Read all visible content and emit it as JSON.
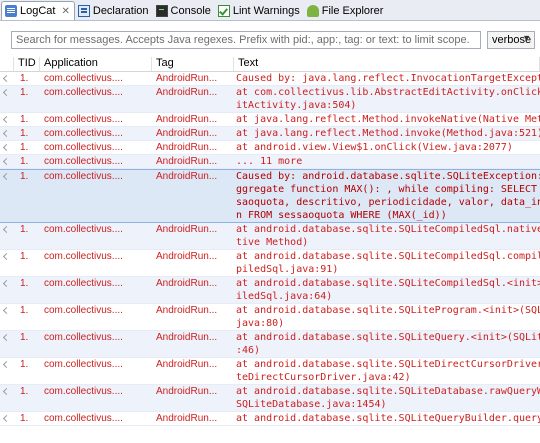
{
  "tabs": [
    {
      "label": "LogCat",
      "icon": "logcat-icon",
      "active": true
    },
    {
      "label": "Declaration",
      "icon": "declaration-icon"
    },
    {
      "label": "Console",
      "icon": "console-icon"
    },
    {
      "label": "Lint Warnings",
      "icon": "lint-warnings-icon"
    },
    {
      "label": "File Explorer",
      "icon": "file-explorer-icon"
    }
  ],
  "close_glyph": "✕",
  "search": {
    "placeholder": "Search for messages. Accepts Java regexes. Prefix with pid:, app:, tag: or text: to limit scope."
  },
  "level_select": {
    "value": "verbose"
  },
  "columns": [
    "TID",
    "Application",
    "Tag",
    "Text"
  ],
  "rows": [
    {
      "tid": "1.",
      "app": "com.collectivus....",
      "tag": "AndroidRun...",
      "text": [
        "Caused by: java.lang.reflect.InvocationTargetException"
      ]
    },
    {
      "tid": "1.",
      "app": "com.collectivus....",
      "tag": "AndroidRun...",
      "text": [
        "at com.collectivus.lib.AbstractEditActivity.onClick(Abstra",
        "itActivity.java:504)"
      ]
    },
    {
      "tid": "1.",
      "app": "com.collectivus....",
      "tag": "AndroidRun...",
      "text": [
        "at java.lang.reflect.Method.invokeNative(Native Method)"
      ]
    },
    {
      "tid": "1.",
      "app": "com.collectivus....",
      "tag": "AndroidRun...",
      "text": [
        "at java.lang.reflect.Method.invoke(Method.java:521)"
      ]
    },
    {
      "tid": "1.",
      "app": "com.collectivus....",
      "tag": "AndroidRun...",
      "text": [
        "at android.view.View$1.onClick(View.java:2077)"
      ]
    },
    {
      "tid": "1.",
      "app": "com.collectivus....",
      "tag": "AndroidRun...",
      "text": [
        "... 11 more"
      ]
    },
    {
      "tid": "1.",
      "app": "com.collectivus....",
      "tag": "AndroidRun...",
      "text": [
        "Caused by: android.database.sqlite.SQLiteException: misuse",
        "ggregate function MAX(): , while compiling: SELECT _id, nc",
        "saoquota, descritivo, periodicidade, valor, data_inici, da",
        "n FROM sessaoquota WHERE (MAX(_id))"
      ],
      "selected": true
    },
    {
      "tid": "1.",
      "app": "com.collectivus....",
      "tag": "AndroidRun...",
      "text": [
        "at android.database.sqlite.SQLiteCompiledSql.native_compil",
        "tive Method)"
      ]
    },
    {
      "tid": "1.",
      "app": "com.collectivus....",
      "tag": "AndroidRun...",
      "text": [
        "at android.database.sqlite.SQLiteCompiledSql.compile(SQLit",
        "piledSql.java:91)"
      ]
    },
    {
      "tid": "1.",
      "app": "com.collectivus....",
      "tag": "AndroidRun...",
      "text": [
        "at android.database.sqlite.SQLiteCompiledSql.<init>(SQLite",
        "iledSql.java:64)"
      ]
    },
    {
      "tid": "1.",
      "app": "com.collectivus....",
      "tag": "AndroidRun...",
      "text": [
        "at android.database.sqlite.SQLiteProgram.<init>(SQLiteProg",
        "java:80)"
      ]
    },
    {
      "tid": "1.",
      "app": "com.collectivus....",
      "tag": "AndroidRun...",
      "text": [
        "at android.database.sqlite.SQLiteQuery.<init>(SQLiteQuery.",
        ":46)"
      ]
    },
    {
      "tid": "1.",
      "app": "com.collectivus....",
      "tag": "AndroidRun...",
      "text": [
        "at android.database.sqlite.SQLiteDirectCursorDriver.query",
        "teDirectCursorDriver.java:42)"
      ]
    },
    {
      "tid": "1.",
      "app": "com.collectivus....",
      "tag": "AndroidRun...",
      "text": [
        "at android.database.sqlite.SQLiteDatabase.rawQueryWithFac",
        "SQLiteDatabase.java:1454)"
      ]
    },
    {
      "tid": "1.",
      "app": "com.collectivus....",
      "tag": "AndroidRun...",
      "text": [
        "at android.database.sqlite.SQLiteQueryBuilder.query(SQLit"
      ]
    }
  ],
  "colors": {
    "error_text": "#cc1f1f",
    "selection": "#dde8f7",
    "tabbar": "#e9ecf2"
  }
}
